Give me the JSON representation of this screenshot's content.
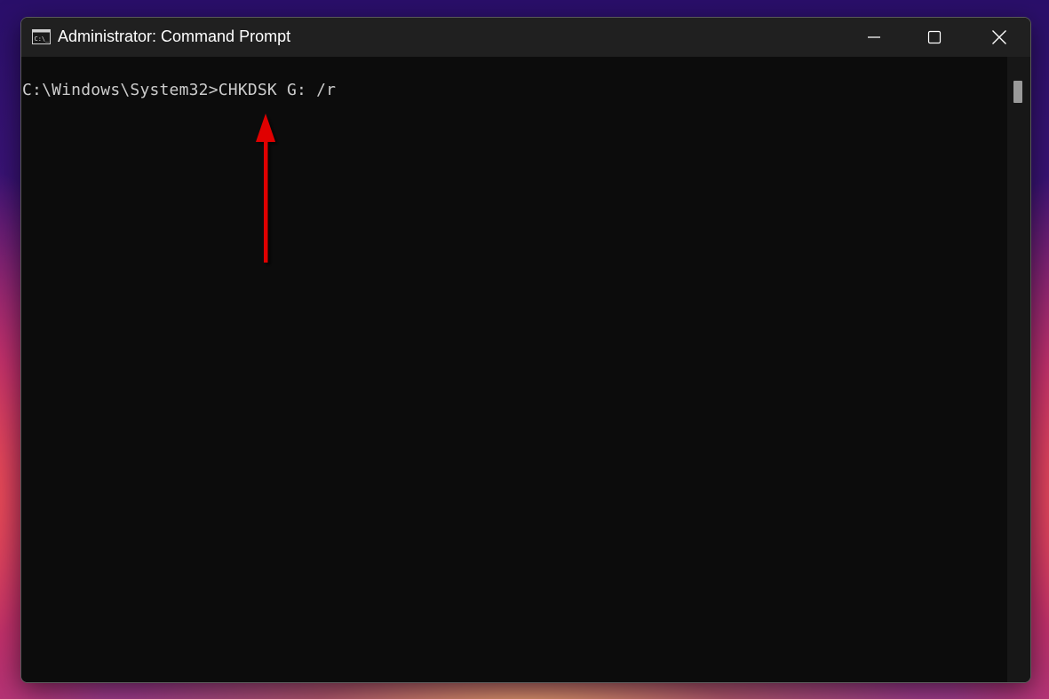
{
  "window": {
    "title": "Administrator: Command Prompt",
    "icons": {
      "app": "cmd-app-icon",
      "minimize": "minimize-icon",
      "maximize": "maximize-icon",
      "close": "close-icon"
    }
  },
  "console": {
    "prompt": "C:\\Windows\\System32>",
    "command": "CHKDSK G: /r"
  },
  "annotation": {
    "icon": "arrow-up-icon",
    "color": "#e00000"
  },
  "colors": {
    "console_background": "#0c0c0c",
    "console_text": "#cccccc",
    "titlebar": "#202020"
  }
}
